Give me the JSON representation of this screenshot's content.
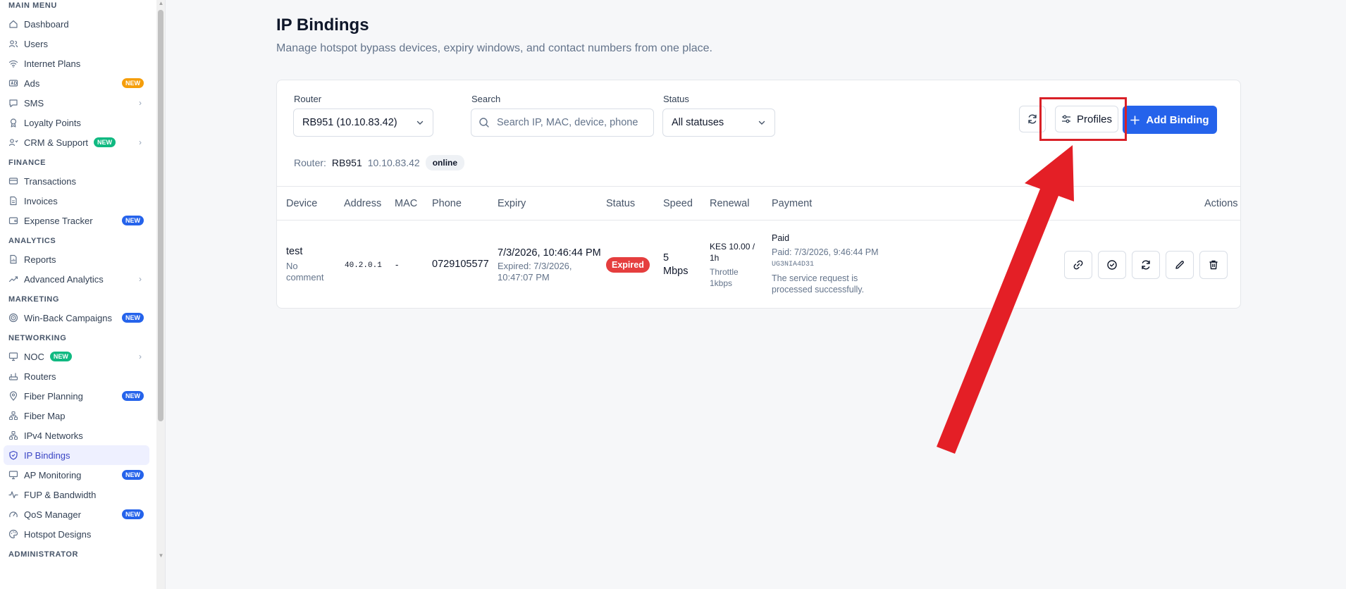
{
  "sidebar": {
    "sections": [
      {
        "title": "MAIN MENU",
        "items": [
          {
            "label": "Dashboard",
            "icon": "home-icon"
          },
          {
            "label": "Users",
            "icon": "users-icon"
          },
          {
            "label": "Internet Plans",
            "icon": "wifi-icon"
          },
          {
            "label": "Ads",
            "icon": "ad-icon",
            "badge": "NEW",
            "badge_color": "orange"
          },
          {
            "label": "SMS",
            "icon": "message-icon",
            "chevron": true
          },
          {
            "label": "Loyalty Points",
            "icon": "award-icon"
          },
          {
            "label": "CRM & Support",
            "icon": "crm-icon",
            "badge": "NEW",
            "badge_color": "green",
            "chevron": true
          }
        ]
      },
      {
        "title": "FINANCE",
        "items": [
          {
            "label": "Transactions",
            "icon": "card-icon"
          },
          {
            "label": "Invoices",
            "icon": "file-icon"
          },
          {
            "label": "Expense Tracker",
            "icon": "wallet-icon",
            "badge": "NEW",
            "badge_color": "blue"
          }
        ]
      },
      {
        "title": "ANALYTICS",
        "items": [
          {
            "label": "Reports",
            "icon": "report-icon"
          },
          {
            "label": "Advanced Analytics",
            "icon": "trend-icon",
            "chevron": true
          }
        ]
      },
      {
        "title": "MARKETING",
        "items": [
          {
            "label": "Win-Back Campaigns",
            "icon": "target-icon",
            "badge": "NEW",
            "badge_color": "blue"
          }
        ]
      },
      {
        "title": "NETWORKING",
        "items": [
          {
            "label": "NOC",
            "icon": "monitor-icon",
            "badge": "NEW",
            "badge_color": "green",
            "chevron": true
          },
          {
            "label": "Routers",
            "icon": "router-icon"
          },
          {
            "label": "Fiber Planning",
            "icon": "pin-icon",
            "badge": "NEW",
            "badge_color": "blue"
          },
          {
            "label": "Fiber Map",
            "icon": "network-icon"
          },
          {
            "label": "IPv4 Networks",
            "icon": "network-icon"
          },
          {
            "label": "IP Bindings",
            "icon": "shield-icon",
            "active": true
          },
          {
            "label": "AP Monitoring",
            "icon": "monitor-icon",
            "badge": "NEW",
            "badge_color": "blue"
          },
          {
            "label": "FUP & Bandwidth",
            "icon": "pulse-icon"
          },
          {
            "label": "QoS Manager",
            "icon": "gauge-icon",
            "badge": "NEW",
            "badge_color": "blue"
          },
          {
            "label": "Hotspot Designs",
            "icon": "palette-icon"
          }
        ]
      },
      {
        "title": "ADMINISTRATOR",
        "items": []
      }
    ]
  },
  "page": {
    "title": "IP Bindings",
    "subtitle": "Manage hotspot bypass devices, expiry windows, and contact numbers from one place."
  },
  "filters": {
    "router_label": "Router",
    "router_value": "RB951 (10.10.83.42)",
    "search_label": "Search",
    "search_placeholder": "Search IP, MAC, device, phone",
    "status_label": "Status",
    "status_value": "All statuses"
  },
  "router_info": {
    "prefix": "Router:",
    "name": "RB951",
    "ip": "10.10.83.42",
    "state": "online"
  },
  "toolbar": {
    "profiles_label": "Profiles",
    "add_label": "Add Binding"
  },
  "table": {
    "headers": [
      "Device",
      "Address",
      "MAC",
      "Phone",
      "Expiry",
      "Status",
      "Speed",
      "Renewal",
      "Payment",
      "Actions"
    ],
    "rows": [
      {
        "device": "test",
        "comment": "No comment",
        "address": "40.2.0.1",
        "mac": "-",
        "phone": "0729105577",
        "expiry": "7/3/2026, 10:46:44 PM",
        "expired_at": "Expired: 7/3/2026, 10:47:07 PM",
        "status": "Expired",
        "speed": "5 Mbps",
        "renewal": "KES 10.00 / 1h",
        "renewal_note": "Throttle 1kbps",
        "payment_status": "Paid",
        "payment_date": "Paid: 7/3/2026, 9:46:44 PM",
        "payment_ref": "UG3NIA4D31",
        "payment_message": "The service request is processed successfully."
      }
    ]
  },
  "colors": {
    "accent": "#2563eb",
    "expired": "#e53e3e",
    "annotation": "#d92027"
  }
}
